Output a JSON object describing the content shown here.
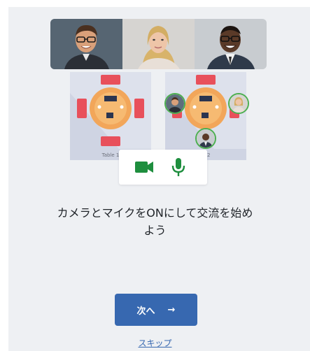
{
  "gallery": {
    "tiles": [
      {
        "icon": "person-photo-glasses-man",
        "bg": "#5e6e7c"
      },
      {
        "icon": "person-photo-blonde-woman",
        "bg": "#d6d4d1"
      },
      {
        "icon": "person-photo-smiling-man",
        "bg": "#c8ccd0"
      }
    ]
  },
  "rooms": {
    "left_label": "Table 1",
    "right_label": "le 2"
  },
  "devices": {
    "camera_icon": "video-camera-icon",
    "mic_icon": "microphone-icon",
    "accent": "#1e8e3e"
  },
  "headline": {
    "line1": "カメラとマイクをONにして交流を始め",
    "line2": "よう"
  },
  "actions": {
    "next_label": "次へ",
    "next_arrow": "→",
    "skip_label": "スキップ"
  },
  "colors": {
    "primary": "#3768b0",
    "table_wood": "#f2a65a",
    "chair_red": "#e8505b",
    "avatar_ring": "#4caf50",
    "panel_bg": "#eef0f3"
  }
}
